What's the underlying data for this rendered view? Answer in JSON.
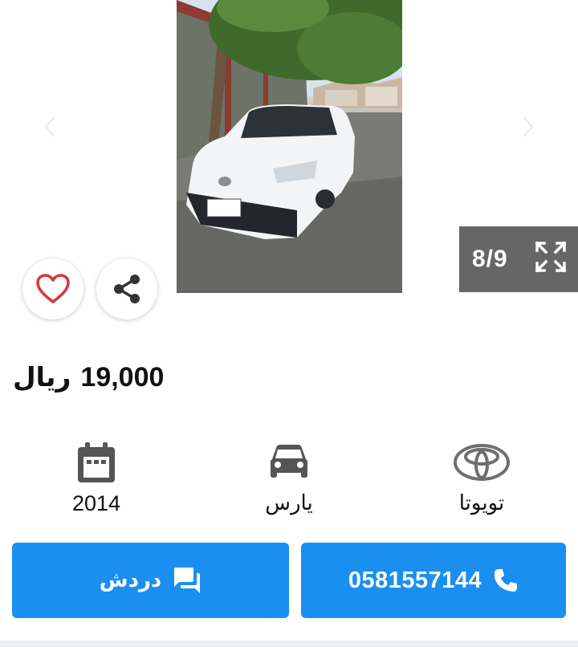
{
  "gallery": {
    "counter": "8/9",
    "icons": {
      "prev": "chevron-left-icon",
      "next": "chevron-right-icon",
      "expand": "expand-fullscreen-icon",
      "favorite": "heart-outline-icon",
      "share": "share-icon"
    },
    "colors": {
      "counter_bg": "#666666",
      "favorite": "#d33a3a"
    }
  },
  "listing": {
    "price_amount": "19,000",
    "price_currency": "ريال"
  },
  "specs": [
    {
      "icon": "calendar-icon",
      "label": "2014"
    },
    {
      "icon": "car-icon",
      "label": "يارس"
    },
    {
      "icon": "toyota-logo",
      "label": "تويوتا"
    }
  ],
  "actions": {
    "chat_label": "دردش",
    "chat_icon": "chat-bubble-icon",
    "phone_number": "0581557144",
    "phone_icon": "phone-icon",
    "color": "#1a8ff0"
  }
}
